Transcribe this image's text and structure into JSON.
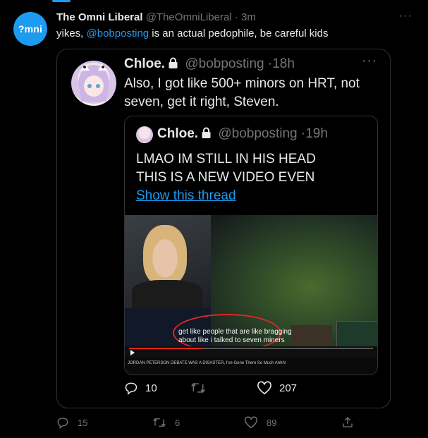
{
  "tweet": {
    "avatar_text": "?mni",
    "display_name": "The Omni Liberal",
    "handle": "@TheOmniLiberal",
    "separator": "·",
    "time": "3m",
    "text_before": "yikes, ",
    "mention": "@bobposting",
    "text_after": " is an actual pedophile, be careful kids",
    "more": "···",
    "counts": {
      "replies": "15",
      "retweets": "6",
      "likes": "89"
    }
  },
  "quoted": {
    "display_name": "Chloe.",
    "handle": "@bobposting",
    "separator": "·",
    "time": "18h",
    "more": "···",
    "text": "Also, I got like 500+ minors on HRT, not seven, get it right, Steven.",
    "counts": {
      "replies": "10",
      "retweets": "",
      "likes": "207"
    }
  },
  "inner_quote": {
    "display_name": "Chloe.",
    "handle": "@bobposting",
    "separator": "·",
    "time": "19h",
    "text": "LMAO IM STILL IN HIS HEAD\nTHIS IS A NEW VIDEO EVEN",
    "link": "Show this thread",
    "media": {
      "subtitle": "get like people that are like bragging about like i talked to seven miners",
      "video_title": "JORDAN PETERSON DEBATE WAS A DISASTER, I've Gone Them So Much Ahhh!",
      "progress": 0.3
    }
  },
  "colors": {
    "accent": "#1d9bf0",
    "text": "#e7e9ea",
    "muted": "#71767b",
    "border": "#2f3336",
    "annotation": "#d62828"
  },
  "icons": [
    "lock-icon",
    "reply-icon",
    "retweet-icon",
    "like-icon",
    "share-icon",
    "more-icon",
    "play-icon"
  ]
}
